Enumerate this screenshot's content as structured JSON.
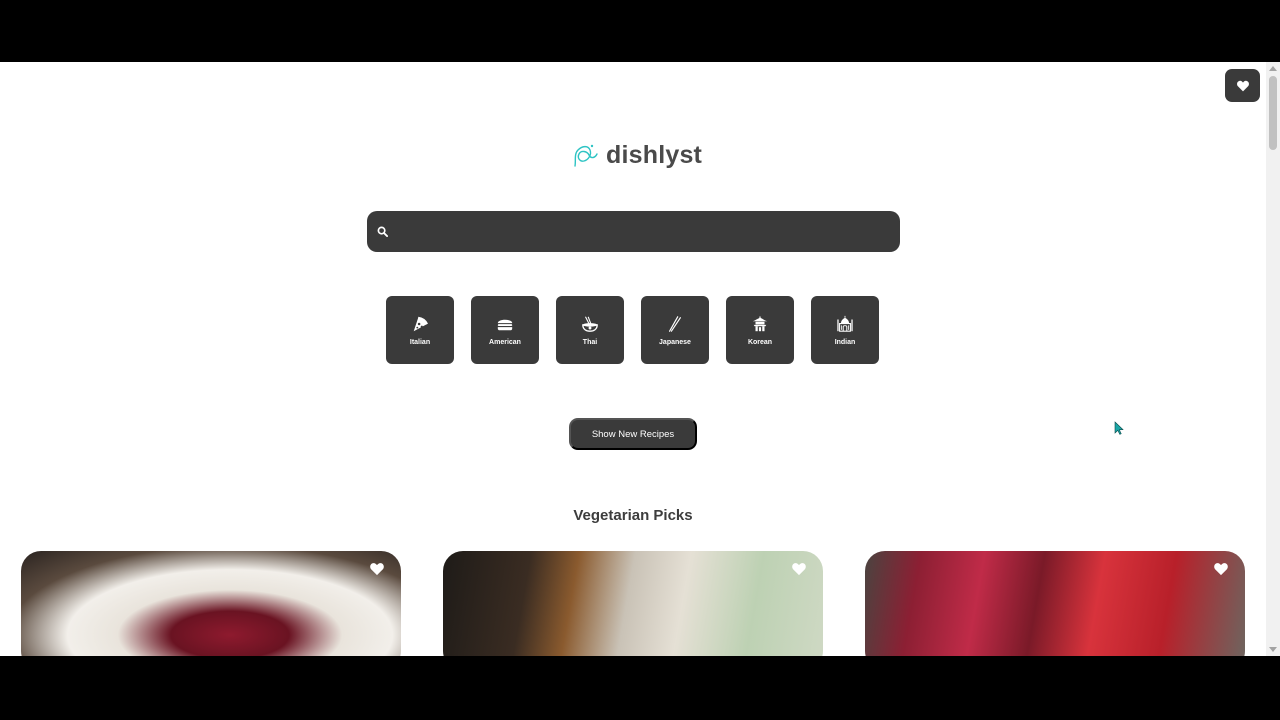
{
  "header": {
    "brand": "dishlyst"
  },
  "search": {
    "value": "",
    "placeholder": ""
  },
  "cuisines": [
    {
      "label": "Italian",
      "icon": "pizza-icon"
    },
    {
      "label": "American",
      "icon": "burger-icon"
    },
    {
      "label": "Thai",
      "icon": "noodle-bowl-icon"
    },
    {
      "label": "Japanese",
      "icon": "chopsticks-icon"
    },
    {
      "label": "Korean",
      "icon": "pagoda-icon"
    },
    {
      "label": "Indian",
      "icon": "taj-mahal-icon"
    }
  ],
  "actions": {
    "show_new_label": "Show New Recipes"
  },
  "section": {
    "title": "Vegetarian Picks"
  },
  "cards": [
    {
      "name": "recipe-card-1",
      "icon": "heart-icon"
    },
    {
      "name": "recipe-card-2",
      "icon": "heart-icon"
    },
    {
      "name": "recipe-card-3",
      "icon": "heart-icon"
    }
  ],
  "colors": {
    "dark_surface": "#3a3a3a",
    "logo_accent": "#2ec4c4",
    "text_dark": "#3d3d3d"
  }
}
